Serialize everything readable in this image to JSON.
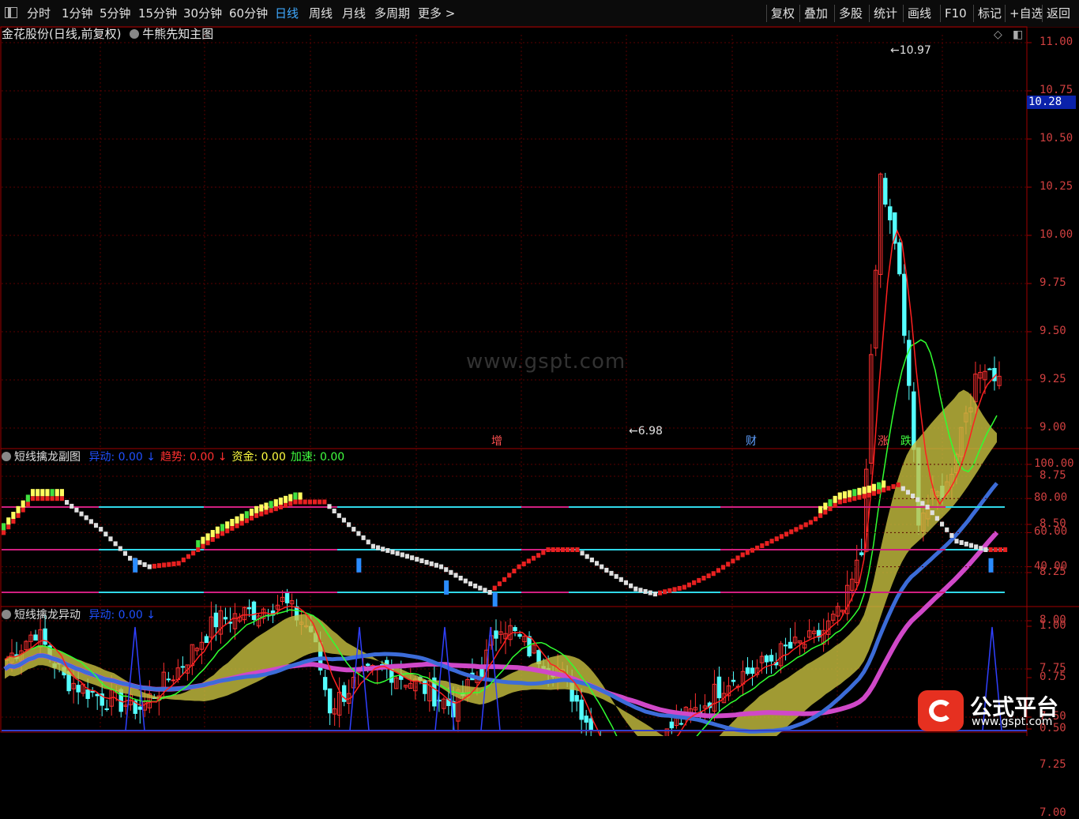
{
  "toolbar": {
    "left_items": [
      "分时",
      "1分钟",
      "5分钟",
      "15分钟",
      "30分钟",
      "60分钟",
      "日线",
      "周线",
      "月线",
      "多周期",
      "更多 >"
    ],
    "active_item": "日线",
    "right_items": [
      "复权",
      "叠加",
      "多股",
      "统计",
      "画线",
      "F10",
      "标记",
      "+自选",
      "返回"
    ]
  },
  "main_chart": {
    "title": "金花股份(日线,前复权)",
    "indicator": "牛熊先知主图",
    "y_ticks": [
      "11.00",
      "10.75",
      "10.50",
      "10.25",
      "10.00",
      "9.75",
      "9.50",
      "9.25",
      "9.00",
      "8.75",
      "8.50",
      "8.25",
      "8.00",
      "7.75",
      "7.50",
      "7.25",
      "7.00"
    ],
    "high_label": "10.97",
    "low_label": "6.98",
    "current_price": "10.28",
    "events": [
      {
        "text": "增",
        "color": "#ff5050"
      },
      {
        "text": "财",
        "color": "#5fa0ff"
      },
      {
        "text": "涨",
        "color": "#ff5050"
      },
      {
        "text": "跌",
        "color": "#40ff40"
      }
    ],
    "watermark": "www.gspt.com",
    "colors": {
      "up": "#ff3030",
      "down": "#54ffff",
      "ma_red": "#ff2020",
      "ma_green": "#30ff30",
      "band_yellow": "#c8c040",
      "band_blue": "#3c6cd8",
      "band_magenta": "#d048c8"
    }
  },
  "sub_chart": {
    "name": "短线擒龙副图",
    "fields": [
      {
        "label": "异动:",
        "value": "0.00",
        "arrow": "↓",
        "color": "#2050ff"
      },
      {
        "label": "趋势:",
        "value": "0.00",
        "arrow": "↓",
        "color": "#ff3030"
      },
      {
        "label": "资金:",
        "value": "0.00",
        "arrow": "",
        "color": "#ffff40"
      },
      {
        "label": "加速:",
        "value": "0.00",
        "arrow": "",
        "color": "#40ff40"
      }
    ],
    "y_ticks": [
      "100.00",
      "80.00",
      "60.00",
      "40.00"
    ]
  },
  "bottom_chart": {
    "name": "短线擒龙异动",
    "field": {
      "label": "异动:",
      "value": "0.00",
      "arrow": "↓",
      "color": "#2050ff"
    },
    "y_ticks": [
      "1.00",
      "0.75",
      "0.50"
    ]
  },
  "logo": {
    "title": "公式平台",
    "url": "www.gspt.com"
  }
}
